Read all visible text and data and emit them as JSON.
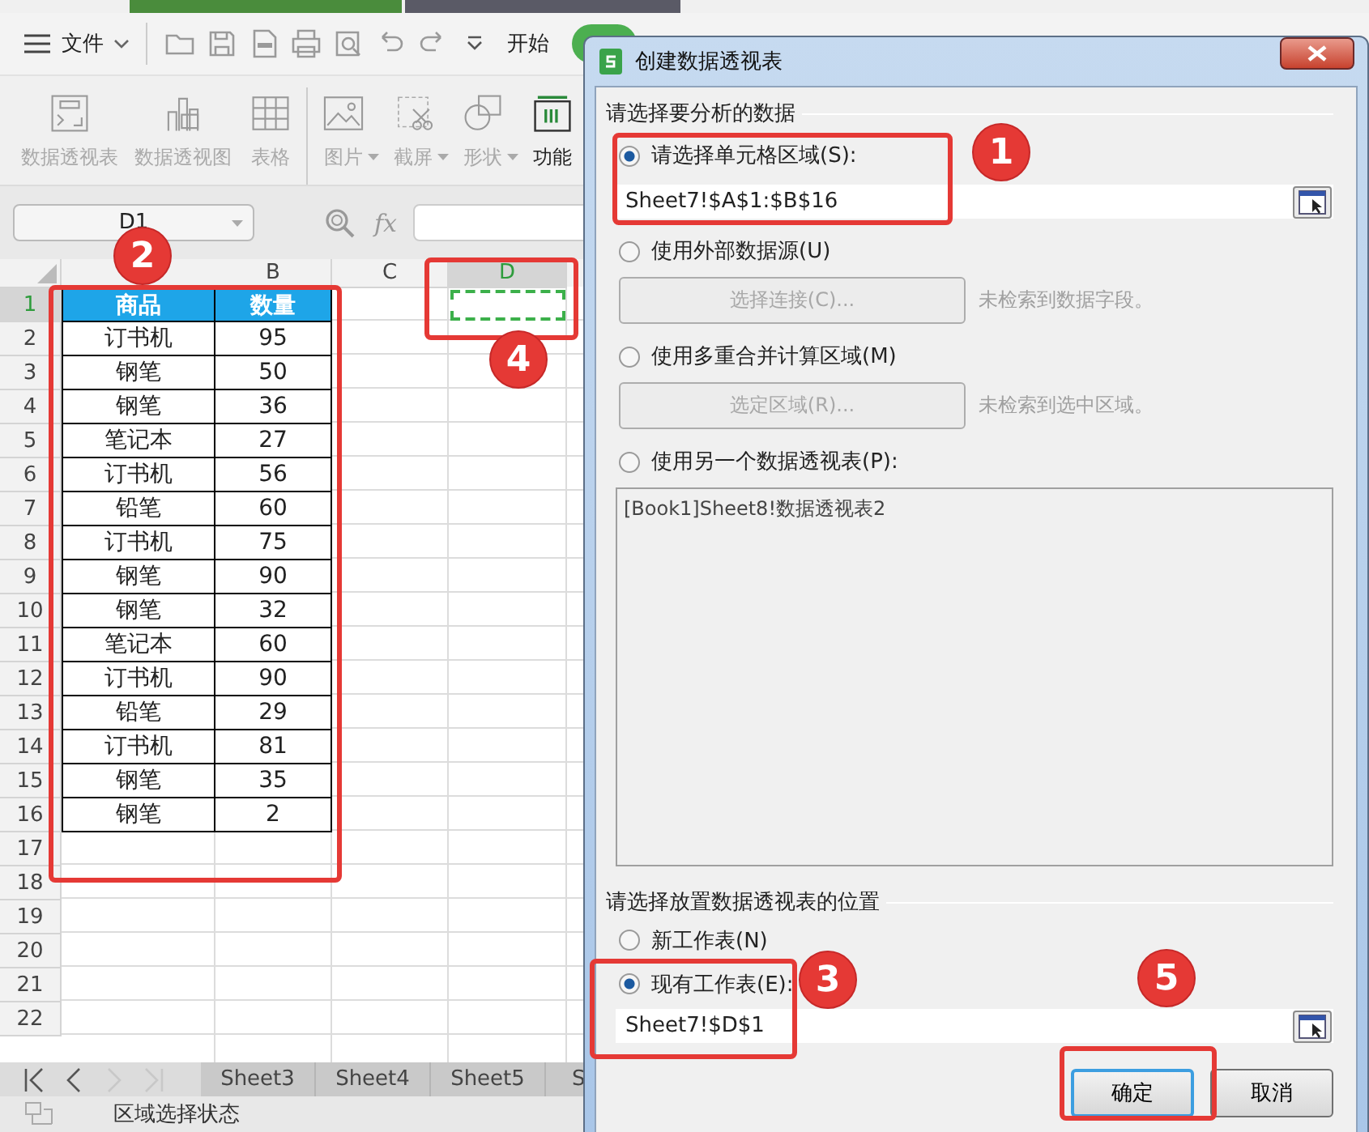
{
  "toolbar": {
    "file_menu": "文件",
    "tabs": [
      {
        "label": "开始",
        "selected": false
      },
      {
        "selected": true
      }
    ]
  },
  "ribbon": [
    {
      "label": "数据透视表",
      "disabled": true,
      "dropdown": false
    },
    {
      "label": "数据透视图",
      "disabled": true,
      "dropdown": false
    },
    {
      "label": "表格",
      "disabled": true,
      "dropdown": false
    },
    {
      "label": "图片",
      "disabled": true,
      "dropdown": true
    },
    {
      "label": "截屏",
      "disabled": true,
      "dropdown": true
    },
    {
      "label": "形状",
      "disabled": true,
      "dropdown": true
    },
    {
      "label": "功能",
      "disabled": false,
      "dropdown": false
    }
  ],
  "formula_bar": {
    "name_box": "D1",
    "fx": "fx"
  },
  "column_headers": [
    {
      "label": "B",
      "selected": false
    },
    {
      "label": "C",
      "selected": false
    },
    {
      "label": "D",
      "selected": true
    }
  ],
  "row_numbers": [
    {
      "label": "1",
      "selected": true
    },
    {
      "label": "2",
      "selected": false
    },
    {
      "label": "3",
      "selected": false
    },
    {
      "label": "4",
      "selected": false
    },
    {
      "label": "5",
      "selected": false
    },
    {
      "label": "6",
      "selected": false
    },
    {
      "label": "7",
      "selected": false
    },
    {
      "label": "8",
      "selected": false
    },
    {
      "label": "9",
      "selected": false
    },
    {
      "label": "10",
      "selected": false
    },
    {
      "label": "11",
      "selected": false
    },
    {
      "label": "12",
      "selected": false
    },
    {
      "label": "13",
      "selected": false
    },
    {
      "label": "14",
      "selected": false
    },
    {
      "label": "15",
      "selected": false
    },
    {
      "label": "16",
      "selected": false
    },
    {
      "label": "17",
      "selected": false
    },
    {
      "label": "18",
      "selected": false
    },
    {
      "label": "19",
      "selected": false
    },
    {
      "label": "20",
      "selected": false
    },
    {
      "label": "21",
      "selected": false
    },
    {
      "label": "22",
      "selected": false
    }
  ],
  "table": {
    "header": [
      "商品",
      "数量"
    ],
    "rows": [
      [
        "订书机",
        "95"
      ],
      [
        "钢笔",
        "50"
      ],
      [
        "钢笔",
        "36"
      ],
      [
        "笔记本",
        "27"
      ],
      [
        "订书机",
        "56"
      ],
      [
        "铅笔",
        "60"
      ],
      [
        "订书机",
        "75"
      ],
      [
        "钢笔",
        "90"
      ],
      [
        "钢笔",
        "32"
      ],
      [
        "笔记本",
        "60"
      ],
      [
        "订书机",
        "90"
      ],
      [
        "铅笔",
        "29"
      ],
      [
        "订书机",
        "81"
      ],
      [
        "钢笔",
        "35"
      ],
      [
        "钢笔",
        "2"
      ]
    ]
  },
  "sheet_tabs": [
    {
      "label": "Sheet3"
    },
    {
      "label": "Sheet4"
    },
    {
      "label": "Sheet5"
    },
    {
      "label": "S"
    }
  ],
  "sheet_nav": [
    {
      "kind": "first",
      "disabled": false
    },
    {
      "kind": "prev",
      "disabled": false
    },
    {
      "kind": "next",
      "disabled": true
    },
    {
      "kind": "last",
      "disabled": true
    }
  ],
  "status_bar": {
    "text": "区域选择状态"
  },
  "dialog": {
    "title": "创建数据透视表",
    "source_legend": "请选择要分析的数据",
    "source_options": [
      {
        "kind": "range",
        "label": "请选择单元格区域(S):",
        "selected": true,
        "value": "Sheet7!$A$1:$B$16"
      },
      {
        "kind": "connection",
        "label": "使用外部数据源(U)",
        "selected": false,
        "button": "选择连接(C)...",
        "hint": "未检索到数据字段。"
      },
      {
        "kind": "connection",
        "label": "使用多重合并计算区域(M)",
        "selected": false,
        "button": "选定区域(R)...",
        "hint": "未检索到选中区域。"
      },
      {
        "kind": "list",
        "label": "使用另一个数据透视表(P):",
        "selected": false,
        "items": [
          "[Book1]Sheet8!数据透视表2"
        ]
      }
    ],
    "target_legend": "请选择放置数据透视表的位置",
    "target_options": [
      {
        "kind": "plain",
        "label": "新工作表(N)",
        "selected": false
      },
      {
        "kind": "range",
        "label": "现有工作表(E):",
        "selected": true,
        "value": "Sheet7!$D$1"
      }
    ],
    "buttons": [
      {
        "label": "确定",
        "default": true
      },
      {
        "label": "取消",
        "default": false
      }
    ]
  },
  "annotations": [
    {
      "number": "1"
    },
    {
      "number": "2"
    },
    {
      "number": "3"
    },
    {
      "number": "4"
    },
    {
      "number": "5"
    }
  ]
}
